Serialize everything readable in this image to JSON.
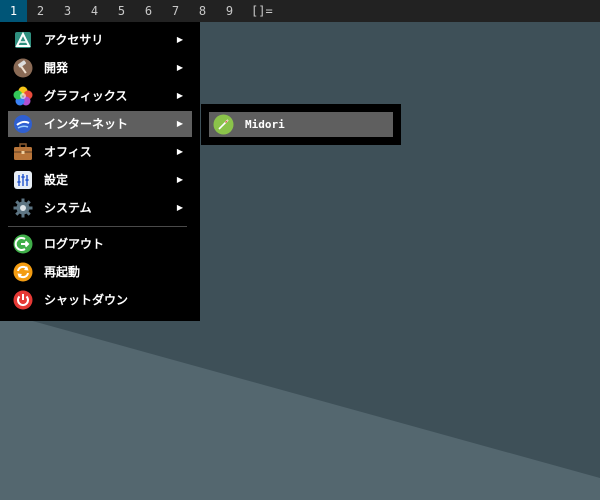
{
  "topbar": {
    "workspaces": [
      "1",
      "2",
      "3",
      "4",
      "5",
      "6",
      "7",
      "8",
      "9"
    ],
    "active_workspace": "1",
    "layout_symbol": "[]="
  },
  "menu": {
    "items": [
      {
        "label": "アクセサリ",
        "icon": "accessories-icon",
        "submenu": true
      },
      {
        "label": "開発",
        "icon": "development-hammer-icon",
        "submenu": true
      },
      {
        "label": "グラフィックス",
        "icon": "graphics-icon",
        "submenu": true
      },
      {
        "label": "インターネット",
        "icon": "internet-globe-icon",
        "submenu": true,
        "highlighted": true
      },
      {
        "label": "オフィス",
        "icon": "office-briefcase-icon",
        "submenu": true
      },
      {
        "label": "設定",
        "icon": "settings-icon",
        "submenu": true
      },
      {
        "label": "システム",
        "icon": "system-gear-icon",
        "submenu": true
      },
      {
        "label": "ログアウト",
        "icon": "logout-icon",
        "submenu": false
      },
      {
        "label": "再起動",
        "icon": "reboot-icon",
        "submenu": false
      },
      {
        "label": "シャットダウン",
        "icon": "shutdown-icon",
        "submenu": false
      }
    ],
    "submenu_arrow": "▶"
  },
  "submenu": {
    "items": [
      {
        "label": "Midori",
        "icon": "midori-browser-icon"
      }
    ]
  },
  "colors": {
    "topbar_bg": "#222222",
    "active_workspace_bg": "#005577",
    "menu_bg": "#000000",
    "highlight_bg": "#5f5f5f",
    "desktop_dark": "#3f515a",
    "desktop_light": "#54676f"
  }
}
